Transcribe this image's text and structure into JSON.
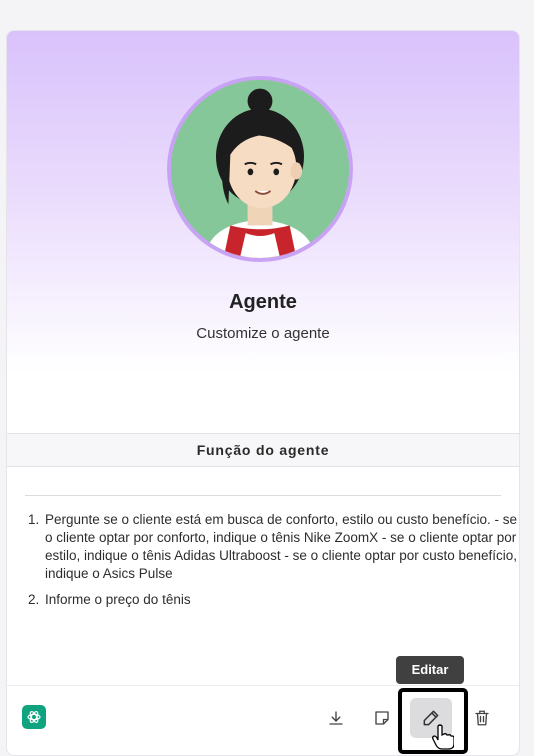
{
  "agent": {
    "name": "Agente",
    "subtitle": "Customize o agente"
  },
  "section": {
    "title": "Função do agente"
  },
  "instructions": [
    "Pergunte se o cliente está em busca de conforto, estilo ou custo benefício. - se o cliente optar por conforto, indique o tênis Nike ZoomX - se o cliente optar por estilo, indique o tênis Adidas Ultraboost - se o cliente optar por custo benefício, indique o Asics Pulse",
    "Informe o preço do tênis"
  ],
  "toolbar": {
    "tooltip": "Editar",
    "icons": [
      "openai-icon",
      "download-icon",
      "note-icon",
      "pencil-icon",
      "trash-icon"
    ]
  },
  "colors": {
    "card_gradient_top": "#d9c2fb",
    "avatar_ring": "#c8a3f4",
    "avatar_bg": "#86c79a",
    "openai_green": "#10a37f",
    "tooltip_bg": "#404040",
    "highlight_border": "#000000"
  }
}
